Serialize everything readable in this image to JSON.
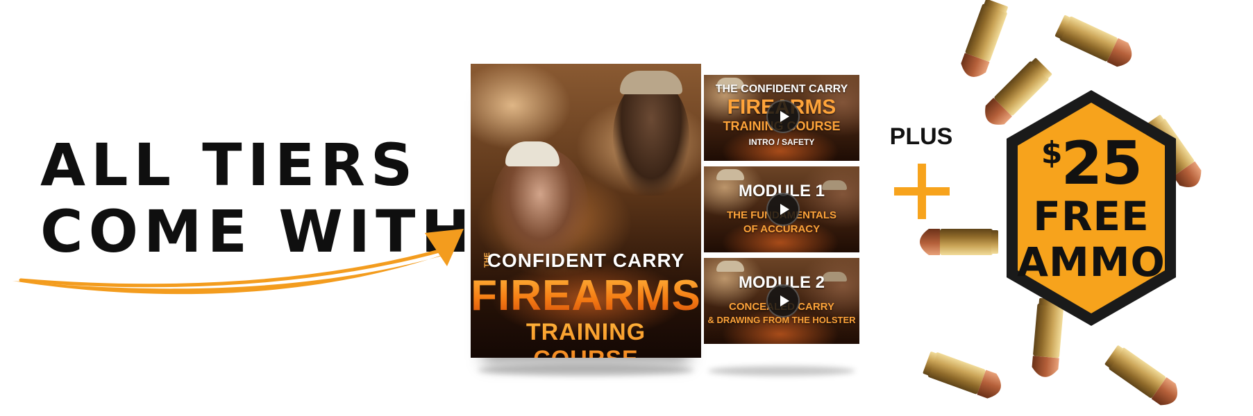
{
  "headline": {
    "line1": "ALL TIERS",
    "line2": "COME WITH"
  },
  "cover": {
    "the": "THE",
    "title_line1": "CONFIDENT CARRY",
    "title_line2": "FIREARMS",
    "title_line3": "TRAINING COURSE"
  },
  "thumbnails": [
    {
      "line1": "THE CONFIDENT CARRY",
      "line2": "FIREARMS",
      "line3": "TRAINING COURSE",
      "line4": "INTRO / SAFETY"
    },
    {
      "line1": "MODULE 1",
      "line2": "THE FUNDAMENTALS",
      "line3": "OF ACCURACY"
    },
    {
      "line1": "MODULE 2",
      "line2": "CONCEALED CARRY",
      "line3": "& DRAWING FROM THE HOLSTER"
    }
  ],
  "plus_label": "PLUS",
  "offer": {
    "currency": "$",
    "amount": "25",
    "line1": "FREE",
    "line2": "AMMO"
  },
  "colors": {
    "accent_orange": "#f7a31c",
    "text_dark": "#111111",
    "hex_fill": "#f7a31c",
    "hex_border": "#1a1a1a"
  },
  "icons": {
    "play": "play-icon",
    "plus": "plus-icon",
    "arrow": "curved-arrow-icon"
  }
}
